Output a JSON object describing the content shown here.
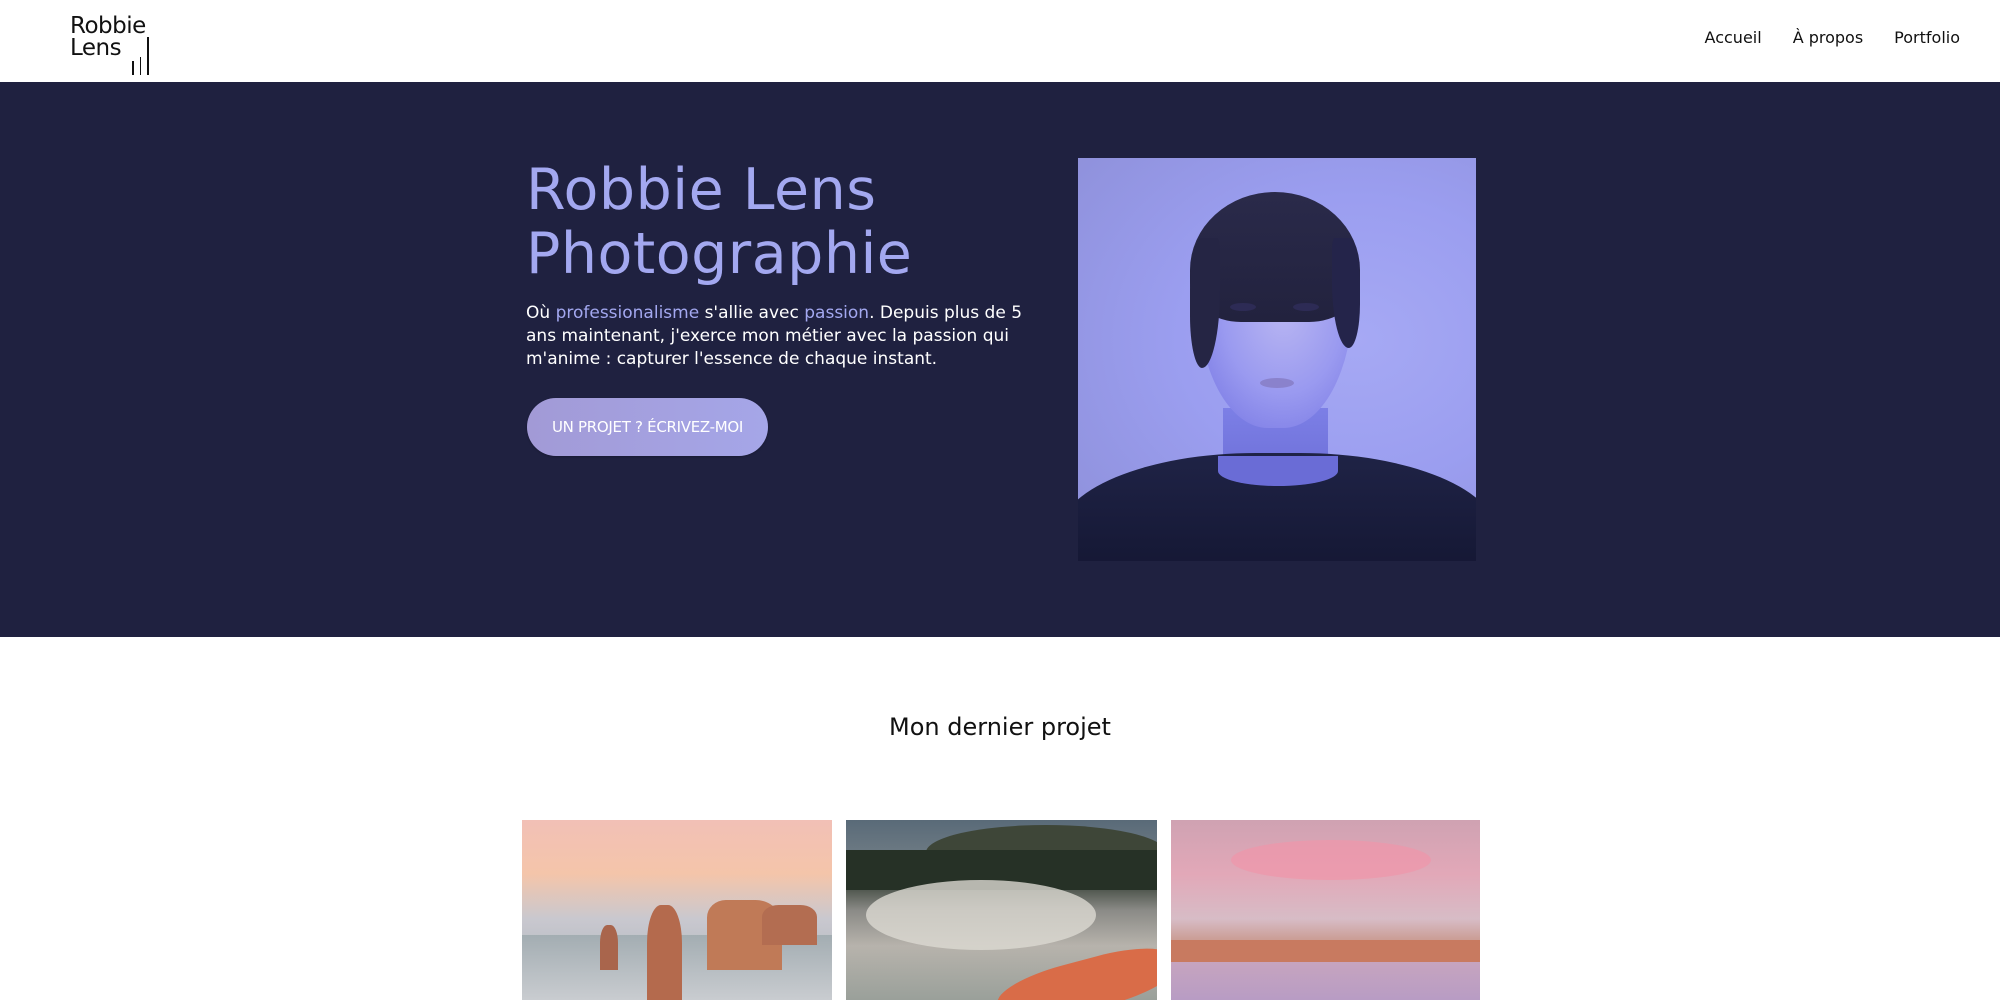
{
  "brand": {
    "logo_line1": "Robbie",
    "logo_line2": "Lens"
  },
  "nav": {
    "items": [
      {
        "label": "Accueil"
      },
      {
        "label": "À propos"
      },
      {
        "label": "Portfolio"
      }
    ]
  },
  "hero": {
    "title_line1": "Robbie Lens",
    "title_line2": "Photographie",
    "desc_part1": "Où ",
    "desc_highlight1": "professionalisme",
    "desc_part2": " s'allie avec ",
    "desc_highlight2": "passion",
    "desc_part3": ". Depuis plus de 5 ans maintenant, j'exerce mon métier avec la passion qui m'anime : capturer l'essence de chaque instant.",
    "cta_label": "UN PROJET ? ÉCRIVEZ-MOI",
    "colors": {
      "background": "#1f2140",
      "accent": "#a3a8f0",
      "button": "#a29ad6"
    }
  },
  "project": {
    "title": "Mon dernier projet",
    "photos": [
      {
        "subject": "coastal-rock-stacks"
      },
      {
        "subject": "geothermal-pool-steam"
      },
      {
        "subject": "pink-sky-beach"
      }
    ]
  }
}
